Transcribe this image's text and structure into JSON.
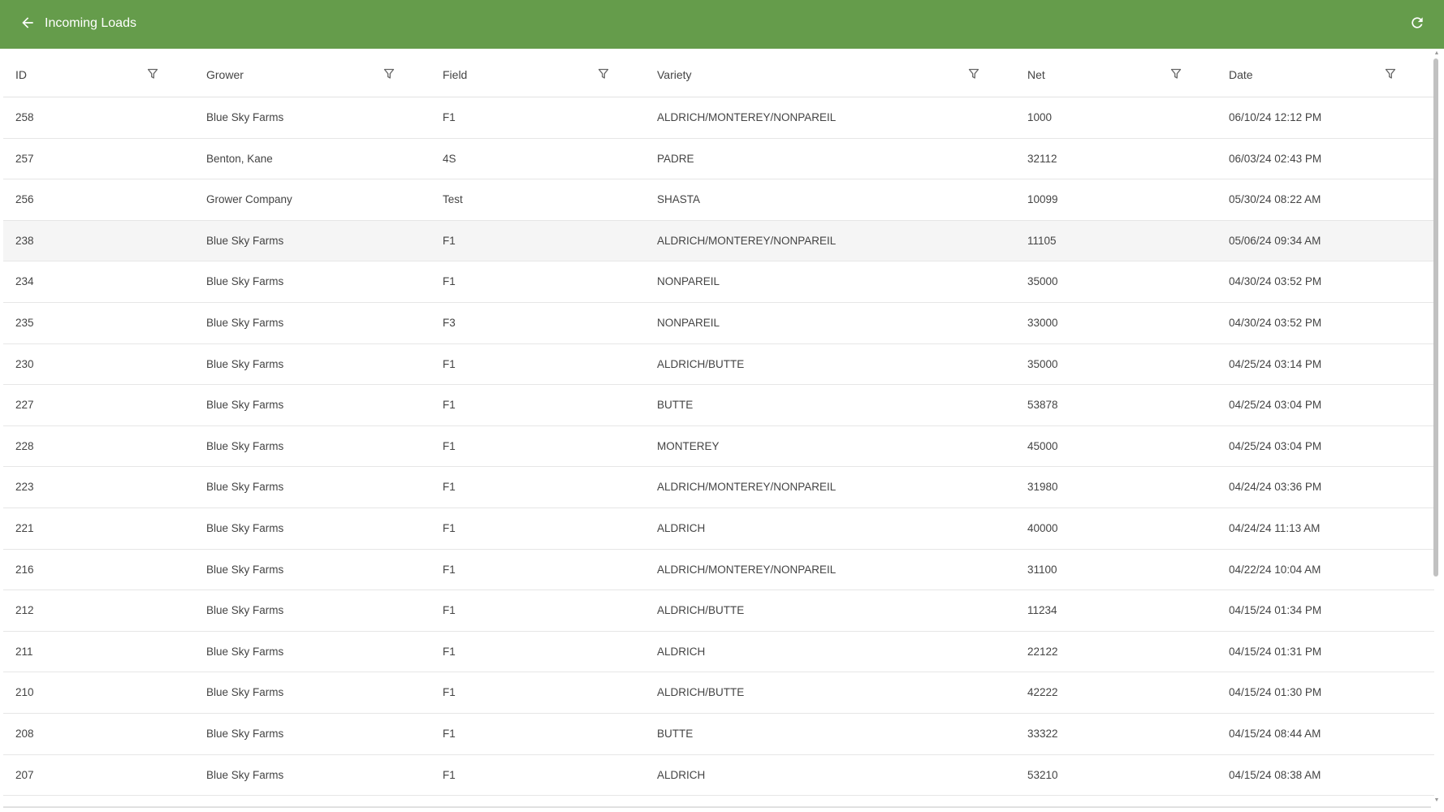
{
  "appbar": {
    "title": "Incoming Loads",
    "back_icon": "arrow-left-icon",
    "refresh_icon": "refresh-icon",
    "color": "#659c4b"
  },
  "table": {
    "columns": [
      {
        "key": "id",
        "label": "ID"
      },
      {
        "key": "grower",
        "label": "Grower"
      },
      {
        "key": "field",
        "label": "Field"
      },
      {
        "key": "variety",
        "label": "Variety"
      },
      {
        "key": "net",
        "label": "Net"
      },
      {
        "key": "date",
        "label": "Date"
      }
    ],
    "rows": [
      {
        "id": "258",
        "grower": "Blue Sky Farms",
        "field": "F1",
        "variety": "ALDRICH/MONTEREY/NONPAREIL",
        "net": "1000",
        "date": "06/10/24 12:12 PM"
      },
      {
        "id": "257",
        "grower": "Benton, Kane",
        "field": "4S",
        "variety": "PADRE",
        "net": "32112",
        "date": "06/03/24 02:43 PM"
      },
      {
        "id": "256",
        "grower": "Grower Company",
        "field": "Test",
        "variety": "SHASTA",
        "net": "10099",
        "date": "05/30/24 08:22 AM"
      },
      {
        "id": "238",
        "grower": "Blue Sky Farms",
        "field": "F1",
        "variety": "ALDRICH/MONTEREY/NONPAREIL",
        "net": "11105",
        "date": "05/06/24 09:34 AM"
      },
      {
        "id": "234",
        "grower": "Blue Sky Farms",
        "field": "F1",
        "variety": "NONPAREIL",
        "net": "35000",
        "date": "04/30/24 03:52 PM"
      },
      {
        "id": "235",
        "grower": "Blue Sky Farms",
        "field": "F3",
        "variety": "NONPAREIL",
        "net": "33000",
        "date": "04/30/24 03:52 PM"
      },
      {
        "id": "230",
        "grower": "Blue Sky Farms",
        "field": "F1",
        "variety": "ALDRICH/BUTTE",
        "net": "35000",
        "date": "04/25/24 03:14 PM"
      },
      {
        "id": "227",
        "grower": "Blue Sky Farms",
        "field": "F1",
        "variety": "BUTTE",
        "net": "53878",
        "date": "04/25/24 03:04 PM"
      },
      {
        "id": "228",
        "grower": "Blue Sky Farms",
        "field": "F1",
        "variety": "MONTEREY",
        "net": "45000",
        "date": "04/25/24 03:04 PM"
      },
      {
        "id": "223",
        "grower": "Blue Sky Farms",
        "field": "F1",
        "variety": "ALDRICH/MONTEREY/NONPAREIL",
        "net": "31980",
        "date": "04/24/24 03:36 PM"
      },
      {
        "id": "221",
        "grower": "Blue Sky Farms",
        "field": "F1",
        "variety": "ALDRICH",
        "net": "40000",
        "date": "04/24/24 11:13 AM"
      },
      {
        "id": "216",
        "grower": "Blue Sky Farms",
        "field": "F1",
        "variety": "ALDRICH/MONTEREY/NONPAREIL",
        "net": "31100",
        "date": "04/22/24 10:04 AM"
      },
      {
        "id": "212",
        "grower": "Blue Sky Farms",
        "field": "F1",
        "variety": "ALDRICH/BUTTE",
        "net": "11234",
        "date": "04/15/24 01:34 PM"
      },
      {
        "id": "211",
        "grower": "Blue Sky Farms",
        "field": "F1",
        "variety": "ALDRICH",
        "net": "22122",
        "date": "04/15/24 01:31 PM"
      },
      {
        "id": "210",
        "grower": "Blue Sky Farms",
        "field": "F1",
        "variety": "ALDRICH/BUTTE",
        "net": "42222",
        "date": "04/15/24 01:30 PM"
      },
      {
        "id": "208",
        "grower": "Blue Sky Farms",
        "field": "F1",
        "variety": "BUTTE",
        "net": "33322",
        "date": "04/15/24 08:44 AM"
      },
      {
        "id": "207",
        "grower": "Blue Sky Farms",
        "field": "F1",
        "variety": "ALDRICH",
        "net": "53210",
        "date": "04/15/24 08:38 AM"
      }
    ],
    "highlighted_row_id": "238",
    "filter_icon": "filter-icon"
  }
}
